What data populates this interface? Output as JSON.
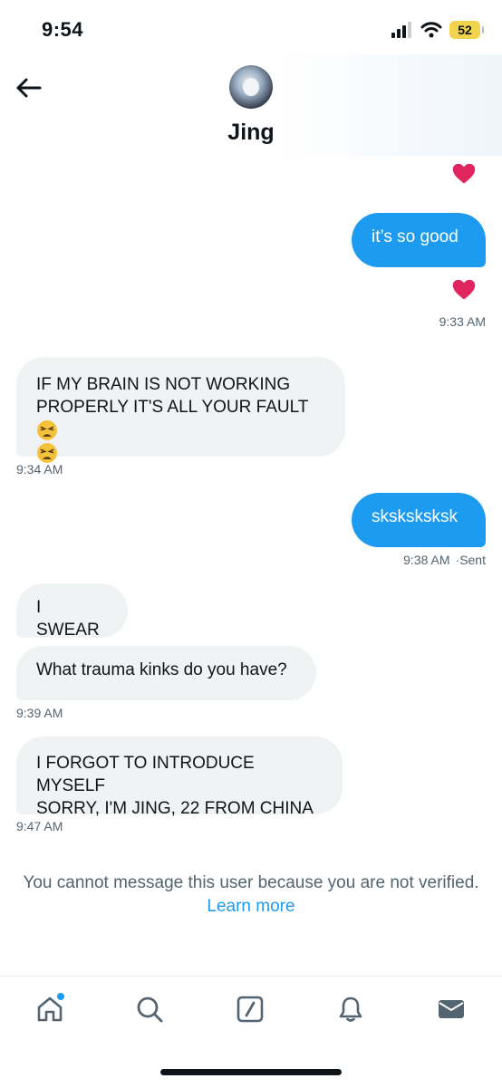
{
  "status_bar": {
    "time": "9:54",
    "battery": "52"
  },
  "header": {
    "contact_name": "Jing"
  },
  "messages": [
    {
      "text": "it’s so good"
    },
    {
      "time": "9:33 AM"
    },
    {
      "text": "IF MY BRAIN IS NOT WORKING PROPERLY IT'S ALL YOUR FAULT",
      "time": "9:34 AM"
    },
    {
      "text": "sksksksksk",
      "time": "9:38 AM",
      "status": "Sent"
    },
    {
      "text": "I SWEAR"
    },
    {
      "text": "What trauma kinks do you have?",
      "time": "9:39 AM"
    },
    {
      "text_line1": "I FORGOT TO INTRODUCE MYSELF",
      "text_line2": "SORRY, I'M JING, 22 FROM CHINA",
      "time": "9:47 AM"
    }
  ],
  "notice": {
    "text": "You cannot message this user because you are not verified.",
    "link": "Learn more"
  },
  "colors": {
    "accent": "#1d9bf0",
    "received_bubble": "#eff3f4",
    "muted_text": "#536471",
    "heart": "#e0245e"
  },
  "icons": {
    "reaction": "heart-icon",
    "weary_face": "weary-face-emoji",
    "tabs": [
      "home-icon",
      "search-icon",
      "compose-icon",
      "bell-icon",
      "mail-icon"
    ]
  }
}
